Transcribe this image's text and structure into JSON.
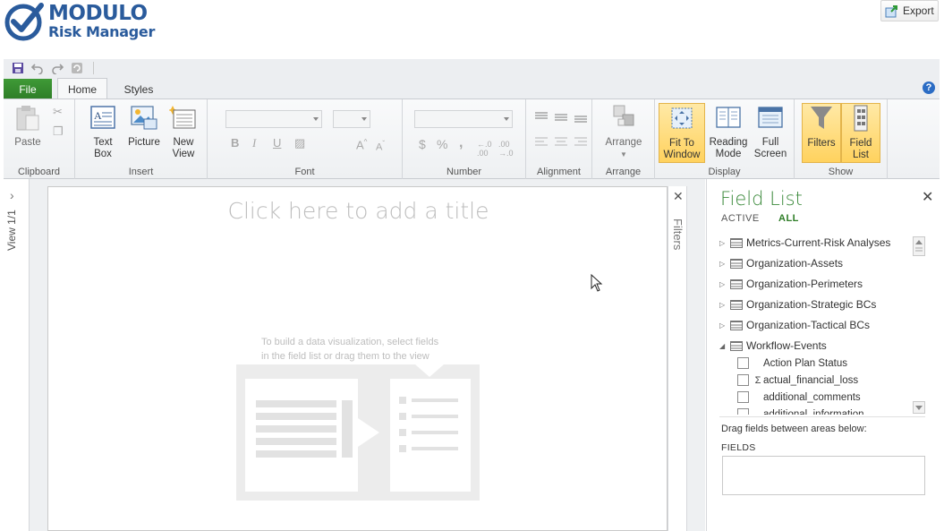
{
  "header": {
    "logo_line1": "MODULO",
    "logo_line2": "Risk Manager",
    "export_label": "Export"
  },
  "qat": {
    "icons": [
      "save-icon",
      "undo-icon",
      "redo-icon",
      "refresh-icon"
    ]
  },
  "tabs": {
    "file": "File",
    "home": "Home",
    "styles": "Styles"
  },
  "ribbon": {
    "clipboard": {
      "label": "Clipboard",
      "paste": "Paste"
    },
    "insert": {
      "label": "Insert",
      "text_box_1": "Text",
      "text_box_2": "Box",
      "picture": "Picture",
      "new_view_1": "New",
      "new_view_2": "View"
    },
    "font": {
      "label": "Font",
      "bold": "B",
      "italic": "I",
      "underline": "U"
    },
    "number": {
      "label": "Number",
      "currency": "$",
      "percent": "%",
      "comma": ","
    },
    "alignment": {
      "label": "Alignment"
    },
    "arrange": {
      "label": "Arrange",
      "button": "Arrange"
    },
    "display": {
      "label": "Display",
      "fit_1": "Fit To",
      "fit_2": "Window",
      "reading_1": "Reading",
      "reading_2": "Mode",
      "full_1": "Full",
      "full_2": "Screen"
    },
    "show": {
      "label": "Show",
      "filters": "Filters",
      "field_1": "Field",
      "field_2": "List"
    }
  },
  "left_rail": {
    "view_label": "View 1/1"
  },
  "canvas": {
    "title_placeholder": "Click here to add a title",
    "hint_line1": "To build a data visualization, select fields",
    "hint_line2": "in the field list or drag them to the view"
  },
  "filters_pane": {
    "label": "Filters"
  },
  "field_list": {
    "title": "Field List",
    "tab_active": "ACTIVE",
    "tab_all": "ALL",
    "tables": [
      {
        "name": "Metrics-Current-Risk Analyses",
        "expanded": false
      },
      {
        "name": "Organization-Assets",
        "expanded": false
      },
      {
        "name": "Organization-Perimeters",
        "expanded": false
      },
      {
        "name": "Organization-Strategic BCs",
        "expanded": false
      },
      {
        "name": "Organization-Tactical BCs",
        "expanded": false
      },
      {
        "name": "Workflow-Events",
        "expanded": true
      }
    ],
    "fields": [
      {
        "name": "Action Plan Status",
        "sigma": ""
      },
      {
        "name": "actual_financial_loss",
        "sigma": "Σ"
      },
      {
        "name": "additional_comments",
        "sigma": ""
      },
      {
        "name": "additional_information",
        "sigma": ""
      }
    ],
    "drag_hint": "Drag fields between areas below:",
    "fields_area_label": "FIELDS"
  },
  "colors": {
    "brand_blue": "#2a5b9c",
    "file_tab_green": "#2e7d27",
    "active_yellow": "#ffd25e",
    "field_list_title": "#3b8a3b"
  }
}
